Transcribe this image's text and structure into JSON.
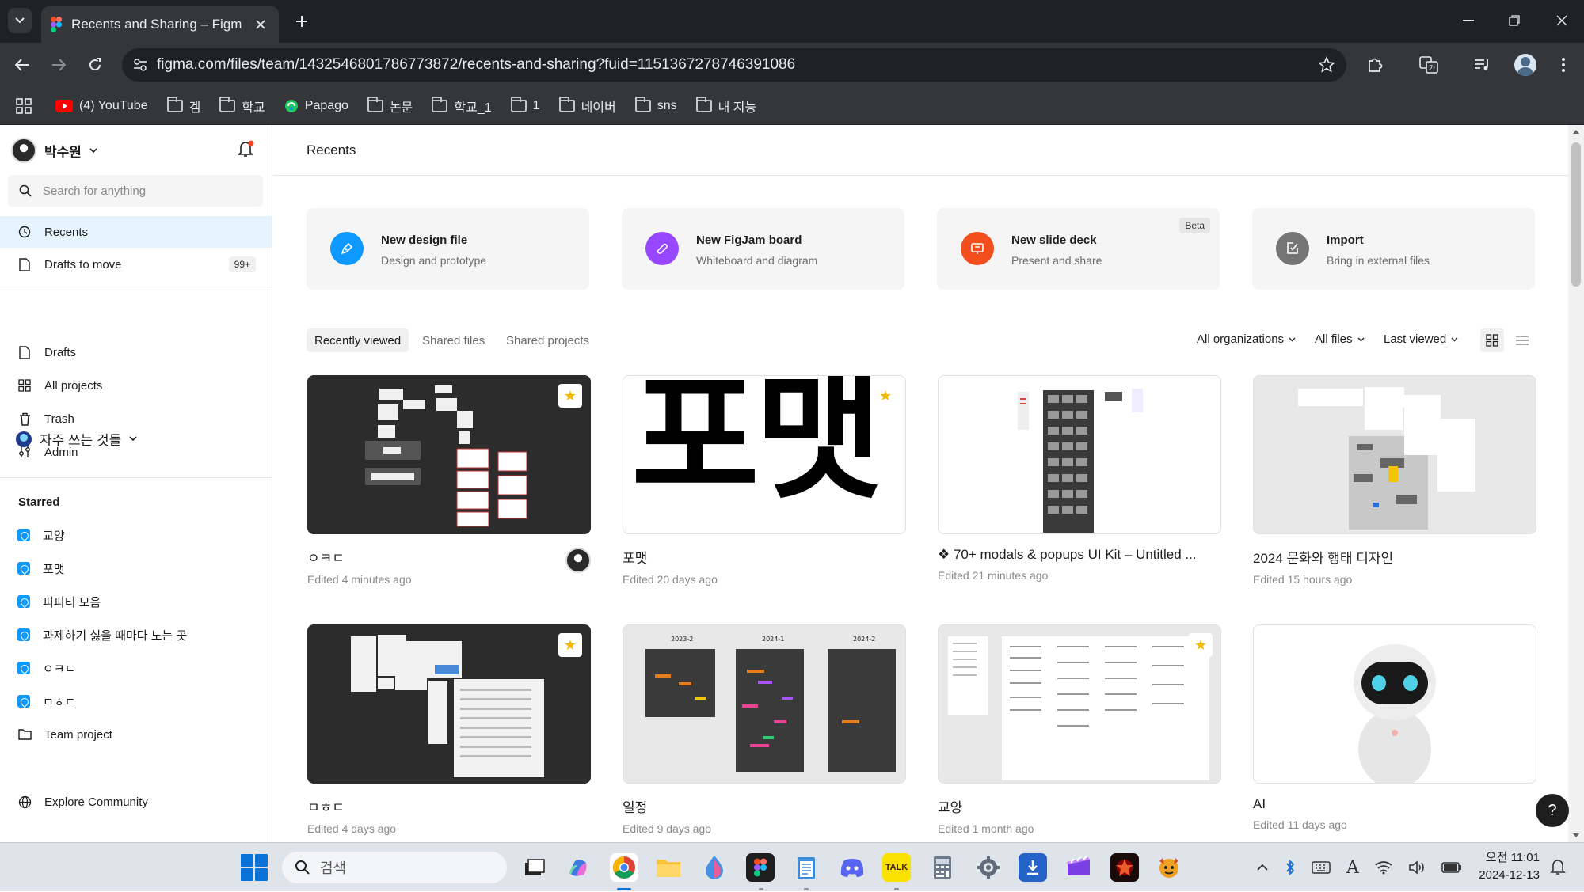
{
  "browser": {
    "tab_title": "Recents and Sharing – Figma",
    "url": "figma.com/files/team/1432546801786773872/recents-and-sharing?fuid=1151367278746391086",
    "bookmarks": [
      {
        "label": "(4) YouTube",
        "icon": "youtube-icon"
      },
      {
        "label": "겜",
        "icon": "folder-icon"
      },
      {
        "label": "학교",
        "icon": "folder-icon"
      },
      {
        "label": "Papago",
        "icon": "papago-icon"
      },
      {
        "label": "논문",
        "icon": "folder-icon"
      },
      {
        "label": "학교_1",
        "icon": "folder-icon"
      },
      {
        "label": "1",
        "icon": "folder-icon"
      },
      {
        "label": "네이버",
        "icon": "folder-icon"
      },
      {
        "label": "sns",
        "icon": "folder-icon"
      },
      {
        "label": "내 지능",
        "icon": "folder-icon"
      }
    ]
  },
  "sidebar": {
    "user_name": "박수원",
    "search_placeholder": "Search for anything",
    "nav": [
      {
        "label": "Recents",
        "icon": "clock-icon",
        "active": true
      },
      {
        "label": "Drafts to move",
        "icon": "file-icon",
        "badge": "99+"
      }
    ],
    "team_name": "자주 쓰는 것들",
    "team_nav": [
      {
        "label": "Drafts",
        "icon": "file-icon"
      },
      {
        "label": "All projects",
        "icon": "grid-icon"
      },
      {
        "label": "Trash",
        "icon": "trash-icon"
      },
      {
        "label": "Admin",
        "icon": "admin-icon"
      }
    ],
    "starred_title": "Starred",
    "starred": [
      {
        "label": "교양",
        "icon": "figma-file-icon"
      },
      {
        "label": "포맷",
        "icon": "figma-file-icon"
      },
      {
        "label": "피피티 모음",
        "icon": "figma-file-icon"
      },
      {
        "label": "과제하기 싫을 때마다 노는 곳",
        "icon": "figma-file-icon"
      },
      {
        "label": "ㅇㅋㄷ",
        "icon": "figma-file-icon"
      },
      {
        "label": "ㅁㅎㄷ",
        "icon": "figma-file-icon"
      },
      {
        "label": "Team project",
        "icon": "folder-icon"
      }
    ],
    "explore": "Explore Community"
  },
  "main": {
    "title": "Recents",
    "create_cards": [
      {
        "title": "New design file",
        "sub": "Design and prototype",
        "icon": "design-file-icon",
        "color": "#0d99ff"
      },
      {
        "title": "New FigJam board",
        "sub": "Whiteboard and diagram",
        "icon": "figjam-icon",
        "color": "#9747ff"
      },
      {
        "title": "New slide deck",
        "sub": "Present and share",
        "icon": "slides-icon",
        "color": "#f24e1e",
        "badge": "Beta"
      },
      {
        "title": "Import",
        "sub": "Bring in external files",
        "icon": "import-icon",
        "color": "#757575"
      }
    ],
    "tabs": [
      "Recently viewed",
      "Shared files",
      "Shared projects"
    ],
    "active_tab": "Recently viewed",
    "filters": {
      "org": "All organizations",
      "files": "All files",
      "sort": "Last viewed"
    },
    "files": [
      {
        "name": "ㅇㅋㄷ",
        "edited": "Edited 4 minutes ago",
        "thumb": "dark",
        "starred": true,
        "owner_avatar": true
      },
      {
        "name": "포맷",
        "edited": "Edited 20 days ago",
        "thumb": "format",
        "starred": true,
        "thumb_text": "포맷"
      },
      {
        "name": "❖ 70+ modals & popups UI Kit – Untitled ...",
        "edited": "Edited 21 minutes ago",
        "thumb": "light",
        "starred": false
      },
      {
        "name": "2024 문화와 행태 디자인",
        "edited": "Edited 15 hours ago",
        "thumb": "light",
        "starred": false
      },
      {
        "name": "ㅁㅎㄷ",
        "edited": "Edited 4 days ago",
        "thumb": "dark",
        "starred": true
      },
      {
        "name": "일정",
        "edited": "Edited 9 days ago",
        "thumb": "schedule",
        "starred": false,
        "thumb_labels": [
          "2023-2",
          "2024-1",
          "2024-2"
        ]
      },
      {
        "name": "교양",
        "edited": "Edited 1 month ago",
        "thumb": "light",
        "starred": true
      },
      {
        "name": "AI",
        "edited": "Edited 11 days ago",
        "thumb": "robot",
        "starred": false
      }
    ],
    "help": "?"
  },
  "taskbar": {
    "search_placeholder": "검색",
    "apps": [
      "task-view",
      "copilot",
      "chrome",
      "file-explorer",
      "edge-like",
      "figma",
      "notepad",
      "discord",
      "kakaotalk",
      "calculator",
      "settings",
      "installer",
      "clipchamp",
      "game",
      "game-2"
    ],
    "kakao_label": "TALK",
    "time": "오전 11:01",
    "date": "2024-12-13",
    "ime": "A"
  }
}
